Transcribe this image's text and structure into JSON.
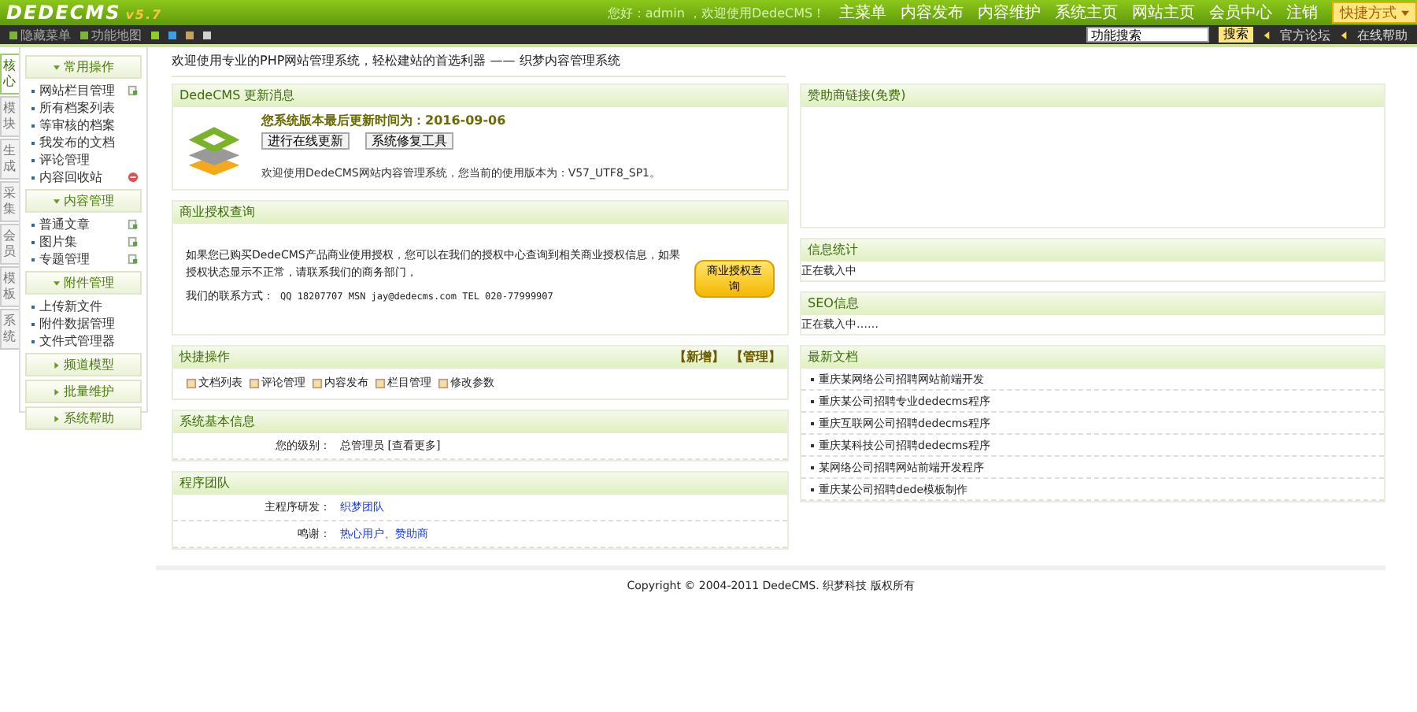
{
  "header": {
    "logo": "DEDECMS",
    "version": "v5.7",
    "greeting": "您好：admin ，欢迎使用DedeCMS！",
    "nav": [
      "主菜单",
      "内容发布",
      "内容维护",
      "系统主页",
      "网站主页",
      "会员中心",
      "注销"
    ],
    "shortcut": "快捷方式"
  },
  "toolbar": {
    "left": [
      "隐藏菜单",
      "功能地图"
    ],
    "skins": [
      {
        "color": "#8ccf2a"
      },
      {
        "color": "#3aa0e0"
      },
      {
        "color": "#c8a060"
      },
      {
        "color": "#d0d0d0"
      }
    ],
    "search": {
      "value": "功能搜索",
      "button": "搜索"
    },
    "links": [
      "官方论坛",
      "在线帮助"
    ]
  },
  "side_tabs": [
    {
      "label": "核心",
      "selected": true
    },
    {
      "label": "模块",
      "selected": false
    },
    {
      "label": "生成",
      "selected": false
    },
    {
      "label": "采集",
      "selected": false
    },
    {
      "label": "会员",
      "selected": false
    },
    {
      "label": "模板",
      "selected": false
    },
    {
      "label": "系统",
      "selected": false
    }
  ],
  "menu": [
    {
      "title": "常用操作",
      "expanded": true,
      "items": [
        {
          "label": "网站栏目管理",
          "kind": "add"
        },
        {
          "label": "所有档案列表"
        },
        {
          "label": "等审核的档案"
        },
        {
          "label": "我发布的文档"
        },
        {
          "label": "评论管理"
        },
        {
          "label": "内容回收站",
          "kind": "trash"
        }
      ]
    },
    {
      "title": "内容管理",
      "expanded": true,
      "items": [
        {
          "label": "普通文章",
          "kind": "add"
        },
        {
          "label": "图片集",
          "kind": "add"
        },
        {
          "label": "专题管理",
          "kind": "add"
        }
      ]
    },
    {
      "title": "附件管理",
      "expanded": true,
      "items": [
        {
          "label": "上传新文件"
        },
        {
          "label": "附件数据管理"
        },
        {
          "label": "文件式管理器"
        }
      ]
    },
    {
      "title": "频道模型",
      "expanded": false
    },
    {
      "title": "批量维护",
      "expanded": false
    },
    {
      "title": "系统帮助",
      "expanded": false
    }
  ],
  "welcome": "欢迎使用专业的PHP网站管理系统，轻松建站的首选利器 —— 织梦内容管理系统",
  "update": {
    "title": "DedeCMS 更新消息",
    "notice": "您系统版本最后更新时间为：2016-09-06",
    "buttons": [
      "进行在线更新",
      "系统修复工具"
    ],
    "version_text": "欢迎使用DedeCMS网站内容管理系统，您当前的使用版本为：V57_UTF8_SP1。"
  },
  "license": {
    "title": "商业授权查询",
    "lines": [
      "如果您已购买DedeCMS产品商业使用授权，您可以在我们的授权中心查询到相关商业授权信息，如果授权状态显示不正常，请联系我们的商务部门，"
    ],
    "contact_label": "我们的联系方式：",
    "contact": "QQ 18207707 MSN jay@dedecms.com TEL 020-77999907",
    "button": "商业授权查询"
  },
  "quick": {
    "title": "快捷操作",
    "actions": [
      "【新增】",
      "【管理】"
    ],
    "items": [
      "文档列表",
      "评论管理",
      "内容发布",
      "栏目管理",
      "修改参数"
    ]
  },
  "sysinfo": {
    "title": "系统基本信息",
    "rows": [
      {
        "label": "您的级别：",
        "value": "总管理员 [查看更多]"
      }
    ]
  },
  "team": {
    "title": "程序团队",
    "rows": [
      {
        "label": "主程序研发：",
        "links": [
          "织梦团队"
        ]
      },
      {
        "label": "鸣谢：",
        "links": [
          "热心用户",
          "赞助商"
        ],
        "separator": "、"
      }
    ]
  },
  "sponsor": {
    "title": "赞助商链接(免费)"
  },
  "stats": {
    "title": "信息统计",
    "text": "正在载入中"
  },
  "seo": {
    "title": "SEO信息",
    "text": "正在载入中……"
  },
  "news": {
    "title": "最新文档",
    "items": [
      "重庆某网络公司招聘网站前端开发",
      "重庆某公司招聘专业dedecms程序",
      "重庆互联网公司招聘dedecms程序",
      "重庆某科技公司招聘dedecms程序",
      "某网络公司招聘网站前端开发程序",
      "重庆某公司招聘dede模板制作"
    ]
  },
  "footer": "Copyright © 2004-2011 DedeCMS. 织梦科技 版权所有"
}
